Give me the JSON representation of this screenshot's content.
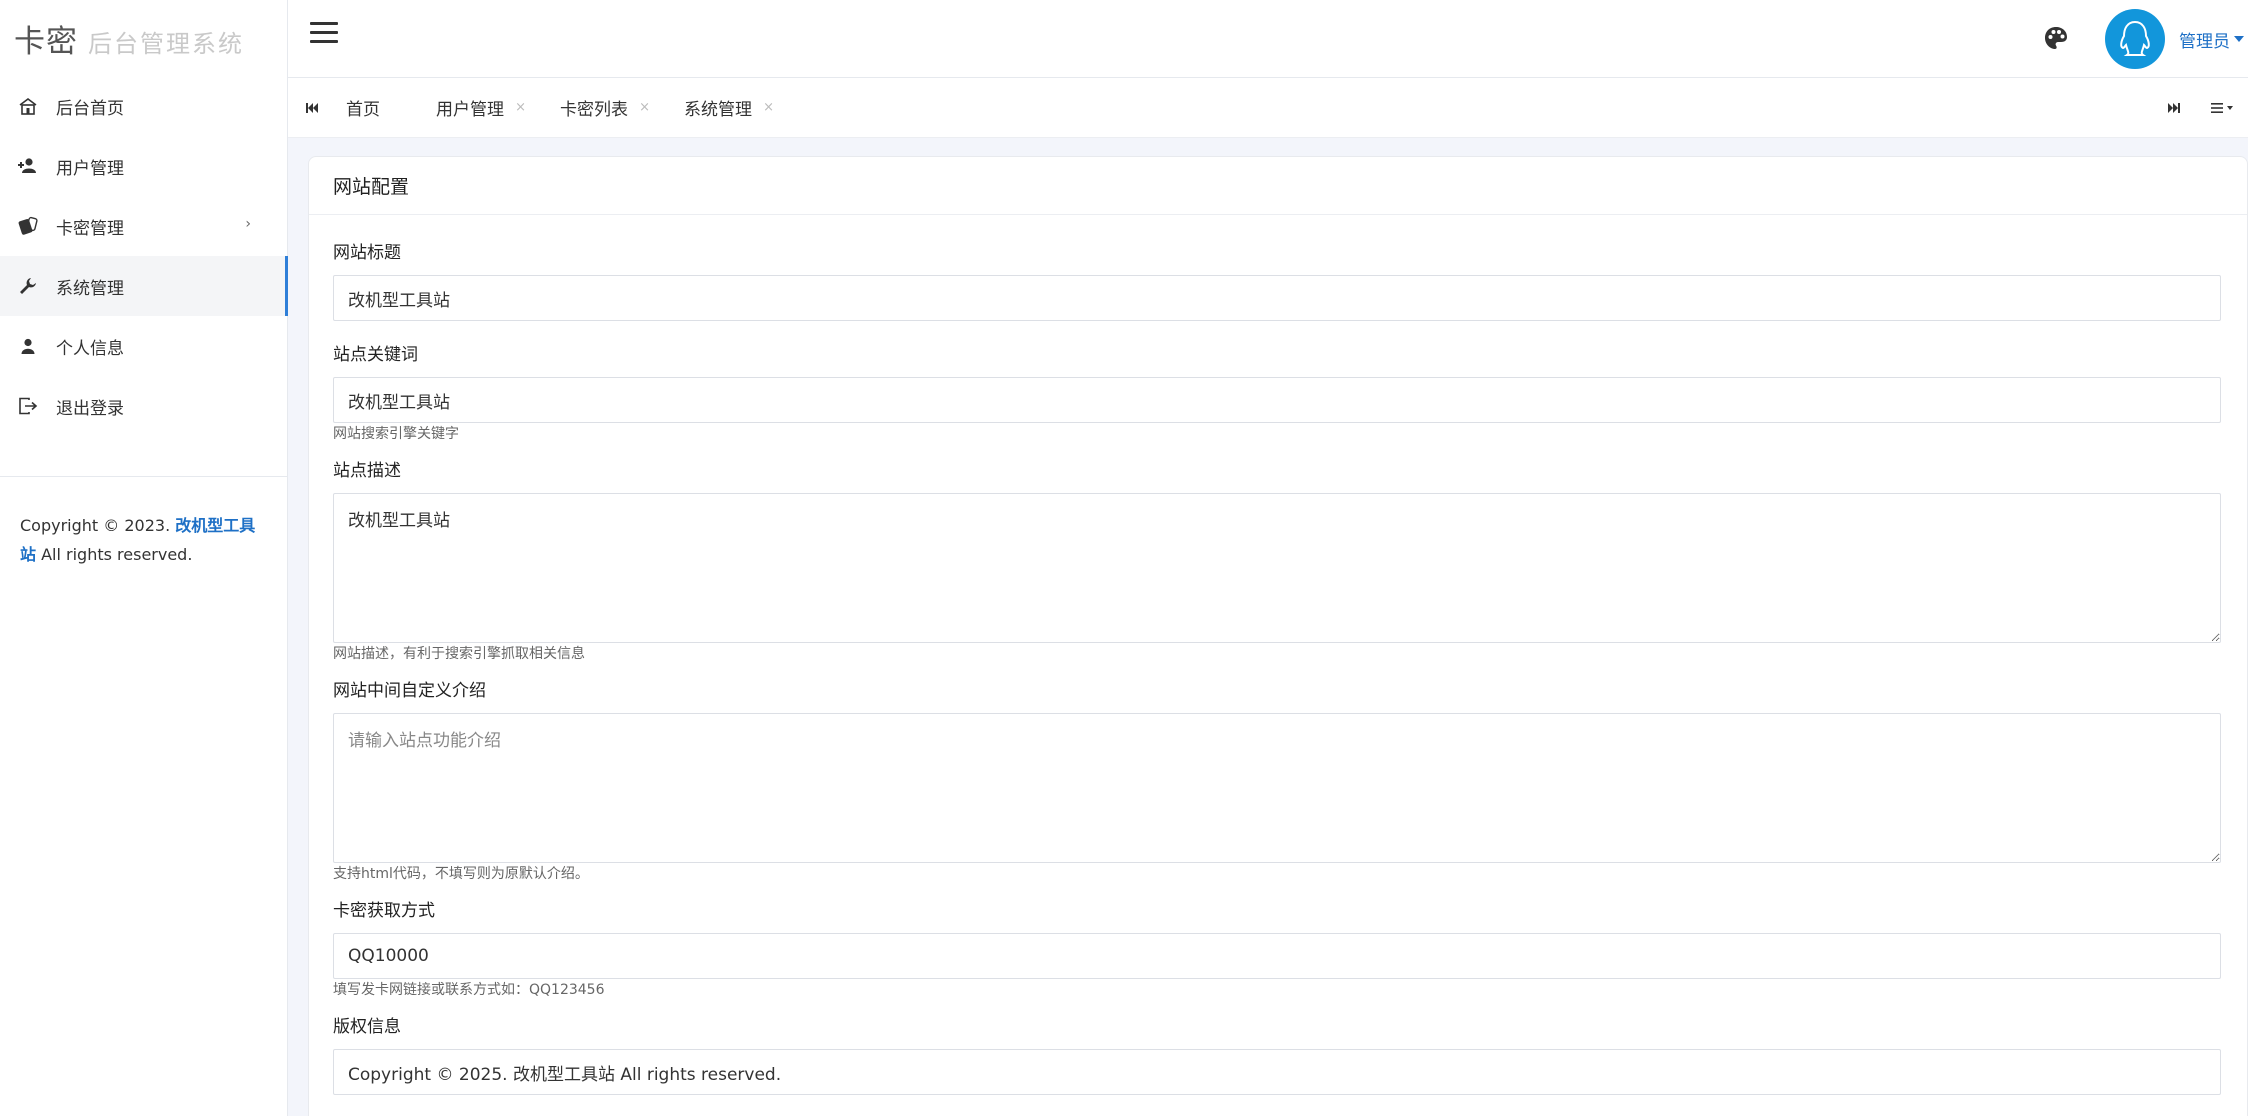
{
  "brand": {
    "logo": "卡密",
    "system_name": "后台管理系统"
  },
  "sidebar": {
    "items": [
      {
        "label": "后台首页",
        "icon": "home-icon"
      },
      {
        "label": "用户管理",
        "icon": "users-icon"
      },
      {
        "label": "卡密管理",
        "icon": "cards-icon",
        "arrow": "›"
      },
      {
        "label": "系统管理",
        "icon": "wrench-icon",
        "active": true
      },
      {
        "label": "个人信息",
        "icon": "user-icon"
      },
      {
        "label": "退出登录",
        "icon": "logout-icon"
      }
    ],
    "copyright": {
      "prefix": "Copyright © 2023. ",
      "link": "改机型工具站",
      "suffix": " All rights reserved."
    }
  },
  "header": {
    "user_name": "管理员"
  },
  "tabs": {
    "items": [
      {
        "label": "首页",
        "closable": false
      },
      {
        "label": "用户管理",
        "closable": true
      },
      {
        "label": "卡密列表",
        "closable": true
      },
      {
        "label": "系统管理",
        "closable": true
      }
    ],
    "close_glyph": "×"
  },
  "card": {
    "title": "网站配置",
    "fields": {
      "site_title": {
        "label": "网站标题",
        "value": "改机型工具站"
      },
      "keywords": {
        "label": "站点关键词",
        "value": "改机型工具站",
        "help": "网站搜索引擎关键字"
      },
      "description": {
        "label": "站点描述",
        "value": "改机型工具站",
        "help": "网站描述，有利于搜索引擎抓取相关信息"
      },
      "intro": {
        "label": "网站中间自定义介绍",
        "value": "",
        "placeholder": "请输入站点功能介绍",
        "help": "支持html代码，不填写则为原默认介绍。"
      },
      "card_method": {
        "label": "卡密获取方式",
        "value": "QQ10000",
        "help": "填写发卡网链接或联系方式如：QQ123456"
      },
      "copyright": {
        "label": "版权信息",
        "value": "Copyright © 2025. 改机型工具站 All rights reserved."
      }
    }
  },
  "colors": {
    "accent": "#1e70c6",
    "avatar_bg": "#1296db",
    "active_bar": "#2f7fd8"
  }
}
